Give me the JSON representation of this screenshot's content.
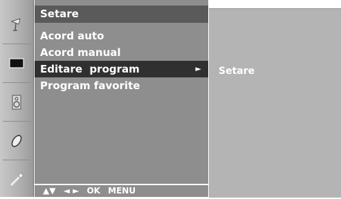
{
  "menu": {
    "title": "Setare",
    "items": [
      {
        "label": "Acord auto"
      },
      {
        "label": "Acord manual"
      },
      {
        "label": "Editare  program",
        "arrow": "►"
      },
      {
        "label": "Program favorite"
      }
    ],
    "footer": {
      "nav_updown": "▲▼",
      "nav_leftright": "◄ ►",
      "ok": "OK",
      "menu": "MENU"
    }
  },
  "submenu": {
    "item": "Setare"
  },
  "icons": [
    "satellite-dish-icon",
    "screen-icon",
    "speaker-icon",
    "clock-icon",
    "key-icon"
  ],
  "colors": {
    "menu_bg": "#8e8e8e",
    "title_bg": "#5a5a5a",
    "selected_bg": "#303030",
    "submenu_bg": "#b4b4b4",
    "strip_bg": "#b0b0b0",
    "text": "#ffffff"
  }
}
